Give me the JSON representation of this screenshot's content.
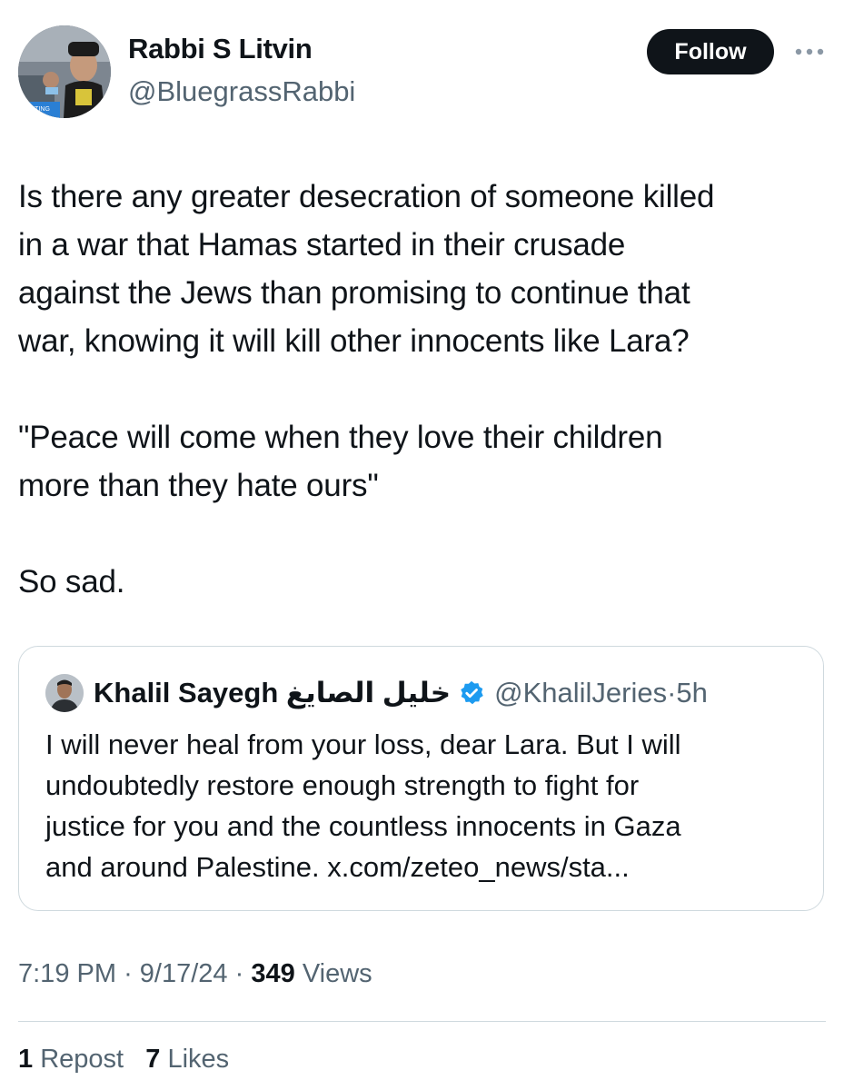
{
  "author": {
    "display_name": "Rabbi S Litvin",
    "handle": "@BluegrassRabbi",
    "avatar_icon": "profile-photo",
    "avatar_caption": "MEETING"
  },
  "actions": {
    "follow_label": "Follow",
    "more_icon": "more-horizontal-icon"
  },
  "tweet": {
    "paragraphs": [
      "Is there any greater desecration of someone killed\nin a war that Hamas started in their crusade\nagainst the Jews than promising to continue that\nwar, knowing it will kill other innocents like Lara?",
      "\"Peace will come when they love their children\nmore than they hate ours\"",
      "So sad."
    ]
  },
  "quoted": {
    "display_name": "Khalil Sayegh خليل الصايغ",
    "verified_icon": "verified-badge-icon",
    "verified_color": "#1d9bf0",
    "handle": "@KhalilJeries",
    "separator": "·",
    "time": "5h",
    "text": "I will never heal from your loss, dear Lara. But I will\nundoubtedly restore enough strength to fight for\njustice for you and the countless innocents in Gaza\nand around Palestine. x.com/zeteo_news/sta..."
  },
  "meta": {
    "time": "7:19 PM",
    "separator": "·",
    "date": "9/17/24",
    "views_count": "349",
    "views_label": "Views"
  },
  "stats": {
    "reposts_count": "1",
    "reposts_label": "Repost",
    "likes_count": "7",
    "likes_label": "Likes"
  },
  "colors": {
    "text_primary": "#0f1419",
    "text_secondary": "#536471",
    "border": "#cfd9de",
    "button_bg": "#0f1419",
    "button_text": "#ffffff"
  }
}
